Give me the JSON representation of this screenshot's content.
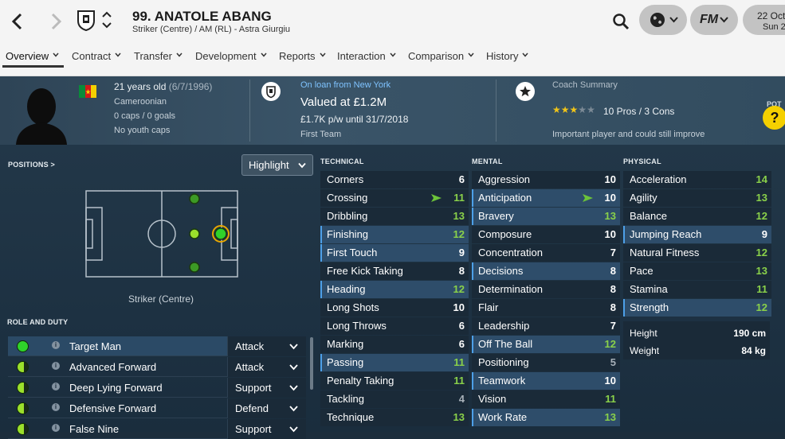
{
  "header": {
    "title": "99. ANATOLE ABANG",
    "subtitle": "Striker (Centre) / AM (RL) - Astra Giurgiu",
    "date_line1": "22 Oct",
    "date_line2": "Sun 2",
    "fm_logo": "FM"
  },
  "tabs": [
    "Overview",
    "Contract",
    "Transfer",
    "Development",
    "Reports",
    "Interaction",
    "Comparison",
    "History"
  ],
  "profile": {
    "age": "21 years old",
    "dob": "(6/7/1996)",
    "nationality": "Cameroonian",
    "caps": "0 caps / 0 goals",
    "youth_caps": "No youth caps",
    "loan": "On loan from New York",
    "value": "Valued at £1.2M",
    "wage": "£1.7K p/w until 31/7/2018",
    "squad": "First Team",
    "coach_summary_label": "Coach Summary",
    "pros_cons": "10 Pros / 3 Cons",
    "star_rating": 3,
    "star_max": 5,
    "summary_text": "Important player and could still improve",
    "potential_label": "POT",
    "potential_value": "?"
  },
  "positions": {
    "header": "POSITIONS >",
    "highlight_label": "Highlight",
    "position_label": "Striker (Centre)"
  },
  "roles": {
    "header": "ROLE AND DUTY",
    "items": [
      {
        "name": "Target Man",
        "duty": "Attack",
        "selected": true
      },
      {
        "name": "Advanced Forward",
        "duty": "Attack",
        "selected": false
      },
      {
        "name": "Deep Lying Forward",
        "duty": "Support",
        "selected": false
      },
      {
        "name": "Defensive Forward",
        "duty": "Defend",
        "selected": false
      },
      {
        "name": "False Nine",
        "duty": "Support",
        "selected": false
      }
    ]
  },
  "attributes": {
    "technical": {
      "header": "TECHNICAL",
      "items": [
        {
          "name": "Corners",
          "value": "6",
          "hl": false,
          "color": "white"
        },
        {
          "name": "Crossing",
          "value": "11",
          "hl": false,
          "color": "green",
          "arrow": true
        },
        {
          "name": "Dribbling",
          "value": "13",
          "hl": false,
          "color": "green"
        },
        {
          "name": "Finishing",
          "value": "12",
          "hl": true,
          "color": "green"
        },
        {
          "name": "First Touch",
          "value": "9",
          "hl": true,
          "color": "white"
        },
        {
          "name": "Free Kick Taking",
          "value": "8",
          "hl": false,
          "color": "white"
        },
        {
          "name": "Heading",
          "value": "12",
          "hl": true,
          "color": "green"
        },
        {
          "name": "Long Shots",
          "value": "10",
          "hl": false,
          "color": "white"
        },
        {
          "name": "Long Throws",
          "value": "6",
          "hl": false,
          "color": "white"
        },
        {
          "name": "Marking",
          "value": "6",
          "hl": false,
          "color": "white"
        },
        {
          "name": "Passing",
          "value": "11",
          "hl": true,
          "color": "green"
        },
        {
          "name": "Penalty Taking",
          "value": "11",
          "hl": false,
          "color": "green"
        },
        {
          "name": "Tackling",
          "value": "4",
          "hl": false,
          "color": "grey"
        },
        {
          "name": "Technique",
          "value": "13",
          "hl": false,
          "color": "green"
        }
      ]
    },
    "mental": {
      "header": "MENTAL",
      "items": [
        {
          "name": "Aggression",
          "value": "10",
          "hl": false,
          "color": "white"
        },
        {
          "name": "Anticipation",
          "value": "10",
          "hl": true,
          "color": "white",
          "arrow": true
        },
        {
          "name": "Bravery",
          "value": "13",
          "hl": true,
          "color": "green"
        },
        {
          "name": "Composure",
          "value": "10",
          "hl": false,
          "color": "white"
        },
        {
          "name": "Concentration",
          "value": "7",
          "hl": false,
          "color": "white"
        },
        {
          "name": "Decisions",
          "value": "8",
          "hl": true,
          "color": "white"
        },
        {
          "name": "Determination",
          "value": "8",
          "hl": false,
          "color": "white"
        },
        {
          "name": "Flair",
          "value": "8",
          "hl": false,
          "color": "white"
        },
        {
          "name": "Leadership",
          "value": "7",
          "hl": false,
          "color": "white"
        },
        {
          "name": "Off The Ball",
          "value": "12",
          "hl": true,
          "color": "green"
        },
        {
          "name": "Positioning",
          "value": "5",
          "hl": false,
          "color": "grey"
        },
        {
          "name": "Teamwork",
          "value": "10",
          "hl": true,
          "color": "white"
        },
        {
          "name": "Vision",
          "value": "11",
          "hl": false,
          "color": "green"
        },
        {
          "name": "Work Rate",
          "value": "13",
          "hl": true,
          "color": "green"
        }
      ]
    },
    "physical": {
      "header": "PHYSICAL",
      "items": [
        {
          "name": "Acceleration",
          "value": "14",
          "hl": false,
          "color": "green"
        },
        {
          "name": "Agility",
          "value": "13",
          "hl": false,
          "color": "green"
        },
        {
          "name": "Balance",
          "value": "12",
          "hl": false,
          "color": "green"
        },
        {
          "name": "Jumping Reach",
          "value": "9",
          "hl": true,
          "color": "white"
        },
        {
          "name": "Natural Fitness",
          "value": "12",
          "hl": false,
          "color": "green"
        },
        {
          "name": "Pace",
          "value": "13",
          "hl": false,
          "color": "green"
        },
        {
          "name": "Stamina",
          "value": "11",
          "hl": false,
          "color": "green"
        },
        {
          "name": "Strength",
          "value": "12",
          "hl": true,
          "color": "green"
        }
      ]
    },
    "height_label": "Height",
    "height_value": "190 cm",
    "weight_label": "Weight",
    "weight_value": "84 kg"
  },
  "colors": {
    "accent_green": "#8ad14a",
    "highlight_blue": "#2e4d6a",
    "potential_yellow": "#f5d000"
  }
}
